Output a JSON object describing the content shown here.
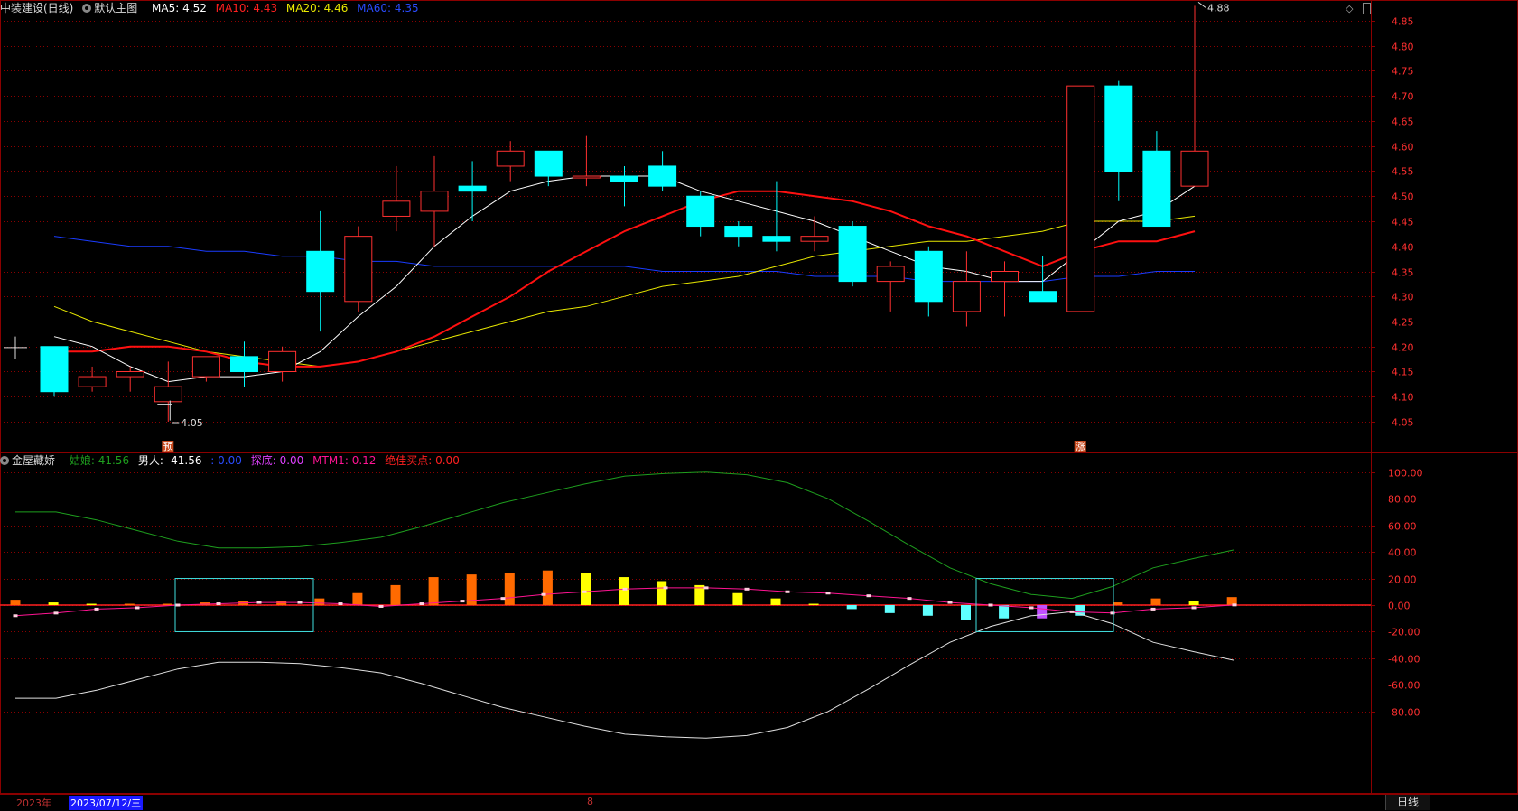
{
  "main_header": {
    "title": "中装建设(日线)",
    "template": "默认主图",
    "ma5_label": "MA5:",
    "ma5_value": "4.52",
    "ma10_label": "MA10:",
    "ma10_value": "4.43",
    "ma20_label": "MA20:",
    "ma20_value": "4.46",
    "ma60_label": "MA60:",
    "ma60_value": "4.35"
  },
  "sub_header": {
    "title": "金屋藏娇",
    "girl_label": "姑娘:",
    "girl_value": "41.56",
    "man_label": "男人:",
    "man_value": "-41.56",
    "blank_label": ":",
    "blank_value": "0.00",
    "probe_label": "探底:",
    "probe_value": "0.00",
    "mtm_label": "MTM1:",
    "mtm_value": "0.12",
    "best_label": "绝佳买点:",
    "best_value": "0.00"
  },
  "bottom_bar": {
    "year": "2023年",
    "date": "2023/07/12/三",
    "month": "8",
    "period": "日线"
  },
  "colors": {
    "up": "#ff3030",
    "down": "#00ffff",
    "ma5": "#ffffff",
    "ma10": "#ff1010",
    "ma20": "#e8e800",
    "ma60": "#1a3cff",
    "girl": "#1e9e1e",
    "man": "#e0e0e0",
    "mtm": "#ff1493",
    "bar_orange": "#ff6a00",
    "bar_yellow": "#ffff00",
    "bar_cyan": "#5fffff",
    "bar_violet": "#c050ff",
    "grid": "#8b0000",
    "axis_text": "#ff3030"
  },
  "chart_data": [
    {
      "type": "candlestick",
      "title": "中装建设(日线)",
      "ylim": [
        4.02,
        4.89
      ],
      "yticks": [
        "4.85",
        "4.80",
        "4.75",
        "4.70",
        "4.65",
        "4.60",
        "4.55",
        "4.50",
        "4.45",
        "4.40",
        "4.35",
        "4.30",
        "4.25",
        "4.20",
        "4.15",
        "4.10",
        "4.05"
      ],
      "ohlc": [
        [
          4.2,
          4.2,
          4.1,
          4.11
        ],
        [
          4.12,
          4.16,
          4.11,
          4.14
        ],
        [
          4.14,
          4.16,
          4.11,
          4.15
        ],
        [
          4.09,
          4.17,
          4.05,
          4.12
        ],
        [
          4.14,
          4.18,
          4.13,
          4.18
        ],
        [
          4.18,
          4.21,
          4.12,
          4.15
        ],
        [
          4.15,
          4.2,
          4.13,
          4.19
        ],
        [
          4.39,
          4.47,
          4.23,
          4.31
        ],
        [
          4.29,
          4.44,
          4.27,
          4.42
        ],
        [
          4.46,
          4.56,
          4.43,
          4.49
        ],
        [
          4.47,
          4.58,
          4.4,
          4.51
        ],
        [
          4.52,
          4.57,
          4.45,
          4.51
        ],
        [
          4.56,
          4.61,
          4.53,
          4.59
        ],
        [
          4.59,
          4.59,
          4.52,
          4.54
        ],
        [
          4.54,
          4.62,
          4.52,
          4.54
        ],
        [
          4.54,
          4.56,
          4.48,
          4.53
        ],
        [
          4.56,
          4.59,
          4.51,
          4.52
        ],
        [
          4.5,
          4.51,
          4.42,
          4.44
        ],
        [
          4.44,
          4.45,
          4.4,
          4.42
        ],
        [
          4.42,
          4.53,
          4.39,
          4.41
        ],
        [
          4.41,
          4.46,
          4.39,
          4.42
        ],
        [
          4.44,
          4.45,
          4.32,
          4.33
        ],
        [
          4.33,
          4.37,
          4.27,
          4.36
        ],
        [
          4.39,
          4.4,
          4.26,
          4.29
        ],
        [
          4.27,
          4.39,
          4.24,
          4.33
        ],
        [
          4.33,
          4.37,
          4.26,
          4.35
        ],
        [
          4.31,
          4.38,
          4.29,
          4.29
        ],
        [
          4.27,
          4.72,
          4.27,
          4.72
        ],
        [
          4.72,
          4.73,
          4.49,
          4.55
        ],
        [
          4.59,
          4.63,
          4.44,
          4.44
        ],
        [
          4.52,
          4.88,
          4.52,
          4.59
        ]
      ],
      "ma5": [
        4.22,
        4.2,
        4.16,
        4.13,
        4.14,
        4.14,
        4.15,
        4.19,
        4.26,
        4.32,
        4.4,
        4.46,
        4.51,
        4.53,
        4.54,
        4.54,
        4.54,
        4.51,
        4.49,
        4.47,
        4.45,
        4.42,
        4.39,
        4.36,
        4.35,
        4.33,
        4.33,
        4.39,
        4.45,
        4.47,
        4.52
      ],
      "ma10": [
        4.19,
        4.19,
        4.2,
        4.2,
        4.19,
        4.17,
        4.16,
        4.16,
        4.17,
        4.19,
        4.22,
        4.26,
        4.3,
        4.35,
        4.39,
        4.43,
        4.46,
        4.49,
        4.51,
        4.51,
        4.5,
        4.49,
        4.47,
        4.44,
        4.42,
        4.39,
        4.36,
        4.39,
        4.41,
        4.41,
        4.43
      ],
      "ma20": [
        4.28,
        4.25,
        4.23,
        4.21,
        4.19,
        4.18,
        4.17,
        4.16,
        4.17,
        4.19,
        4.21,
        4.23,
        4.25,
        4.27,
        4.28,
        4.3,
        4.32,
        4.33,
        4.34,
        4.36,
        4.38,
        4.39,
        4.4,
        4.41,
        4.41,
        4.42,
        4.43,
        4.45,
        4.45,
        4.45,
        4.46
      ],
      "ma60": [
        4.42,
        4.41,
        4.4,
        4.4,
        4.39,
        4.39,
        4.38,
        4.38,
        4.37,
        4.37,
        4.36,
        4.36,
        4.36,
        4.36,
        4.36,
        4.36,
        4.35,
        4.35,
        4.35,
        4.35,
        4.34,
        4.34,
        4.34,
        4.33,
        4.33,
        4.33,
        4.33,
        4.34,
        4.34,
        4.35,
        4.35
      ],
      "annotations": {
        "high_label": "4.88",
        "low_label": "4.05",
        "marker_1": "预",
        "marker_2": "涨"
      }
    },
    {
      "type": "indicator",
      "title": "金屋藏娇",
      "ylim": [
        -100,
        110
      ],
      "yticks": [
        "100.00",
        "80.00",
        "60.00",
        "40.00",
        "20.00",
        "0.00",
        "-20.00",
        "-40.00",
        "-60.00",
        "-80.00"
      ],
      "series": [
        {
          "name": "姑娘",
          "values": [
            70,
            70,
            64,
            56,
            48,
            43,
            43,
            44,
            47,
            51,
            59,
            68,
            77,
            84,
            91,
            97,
            99,
            100,
            98,
            92,
            80,
            63,
            45,
            28,
            16,
            8,
            5,
            14,
            28,
            35,
            41.56
          ]
        },
        {
          "name": "男人",
          "values": [
            -70,
            -70,
            -64,
            -56,
            -48,
            -43,
            -43,
            -44,
            -47,
            -51,
            -59,
            -68,
            -77,
            -84,
            -91,
            -97,
            -99,
            -100,
            -98,
            -92,
            -80,
            -63,
            -45,
            -28,
            -16,
            -8,
            -5,
            -14,
            -28,
            -35,
            -41.56
          ]
        },
        {
          "name": "MTM1",
          "values": [
            -8,
            -6,
            -3,
            -2,
            0,
            1,
            2,
            2,
            1,
            -1,
            1,
            3,
            5,
            8,
            10,
            12,
            13,
            13,
            12,
            10,
            9,
            7,
            5,
            2,
            0,
            -2,
            -5,
            -6,
            -3,
            -2,
            0.12
          ]
        }
      ],
      "bars": {
        "values": [
          4,
          2,
          1,
          1,
          1,
          2,
          3,
          3,
          5,
          9,
          15,
          21,
          23,
          24,
          26,
          24,
          21,
          18,
          15,
          9,
          5,
          1,
          -3,
          -6,
          -8,
          -11,
          -10,
          -10,
          -8,
          2,
          5,
          3,
          6
        ],
        "colors": [
          "orange",
          "yellow",
          "yellow",
          "orange",
          "orange",
          "orange",
          "orange",
          "orange",
          "orange",
          "orange",
          "orange",
          "orange",
          "orange",
          "orange",
          "orange",
          "yellow",
          "yellow",
          "yellow",
          "yellow",
          "yellow",
          "yellow",
          "yellow",
          "cyan",
          "cyan",
          "cyan",
          "cyan",
          "cyan",
          "violet",
          "cyan",
          "orange",
          "orange",
          "yellow",
          "orange"
        ]
      }
    }
  ]
}
